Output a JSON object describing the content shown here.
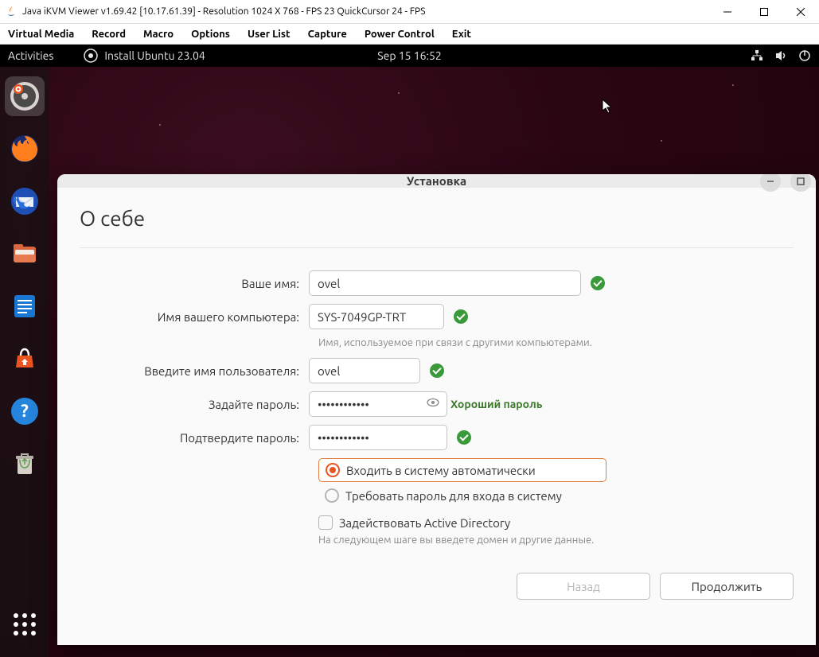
{
  "win_title": "Java iKVM Viewer v1.69.42 [10.17.61.39]  -  Resolution 1024 X 768 - FPS 23 QuickCursor 24 - FPS",
  "java_menu": [
    "Virtual Media",
    "Record",
    "Macro",
    "Options",
    "User List",
    "Capture",
    "Power Control",
    "Exit"
  ],
  "gnome": {
    "activities": "Activities",
    "app": "Install Ubuntu 23.04",
    "clock": "Sep 15  16:52"
  },
  "installer": {
    "title": "Установка",
    "heading": "О себе",
    "labels": {
      "name": "Ваше имя:",
      "hostname": "Имя вашего компьютера:",
      "username": "Введите имя пользователя:",
      "password": "Задайте пароль:",
      "confirm": "Подтвердите пароль:"
    },
    "values": {
      "name": "ovel",
      "hostname": "SYS-7049GP-TRT",
      "username": "ovel",
      "password": "••••••••••••",
      "confirm": "••••••••••••"
    },
    "hostname_hint": "Имя, используемое при связи с другими компьютерами.",
    "pass_strength": "Хороший пароль",
    "radio_auto": "Входить в систему автоматически",
    "radio_require": "Требовать пароль для входа в систему",
    "ad_checkbox": "Задействовать Active Directory",
    "ad_hint": "На следующем шаге вы введете домен и другие данные.",
    "back": "Назад",
    "continue": "Продолжить"
  }
}
